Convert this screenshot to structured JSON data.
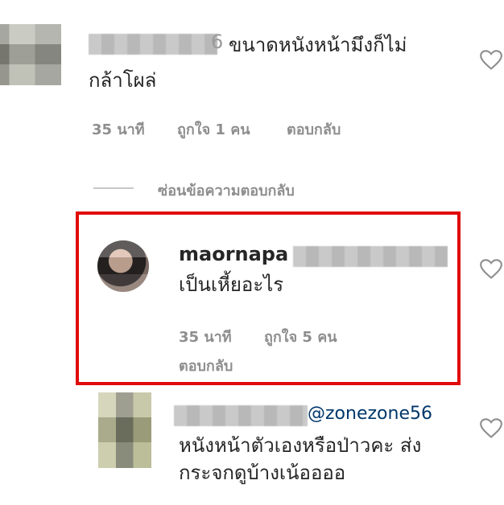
{
  "comments": [
    {
      "text": "ขนาดหนังหน้ามึงก็ไม่กล้าโผล่",
      "text_line1": "ขนาดหนังหน้ามึงก็ไม่",
      "text_line2": "กล้าโผล่",
      "time": "35 นาที",
      "likes": "ถูกใจ 1 คน",
      "reply": "ตอบกลับ",
      "username_suffix": "6"
    },
    {
      "username": "maornapa",
      "text": "เป็นเหี้ยอะไร",
      "time": "35 นาที",
      "likes": "ถูกใจ 5 คน",
      "reply": "ตอบกลับ"
    },
    {
      "mention": "@zonezone56",
      "text_line1": "หนังหน้าตัวเองหรือป่าวคะ ส่ง",
      "text_line2": "กระจกดูบ้างเน้ออออ"
    }
  ],
  "hide_replies": "ซ่อนข้อความตอบกลับ",
  "colors": {
    "highlight_border": "#e10a0a",
    "meta_text": "#8e8e8e",
    "mention": "#00376b"
  },
  "icons": [
    "heart-icon"
  ]
}
